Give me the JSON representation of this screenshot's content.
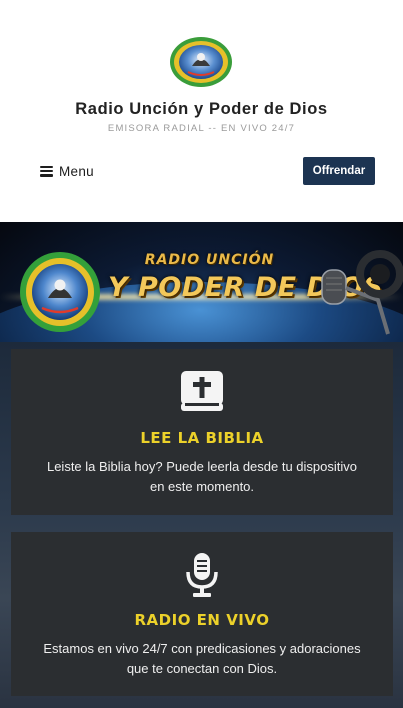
{
  "header": {
    "site_title": "Radio Unción y Poder de Dios",
    "tagline": "EMISORA RADIAL -- EN VIVO 24/7",
    "menu_label": "Menu",
    "donate_label": "Offrendar"
  },
  "banner": {
    "line1": "RADIO UNCIÓN",
    "line2": "Y PODER DE DIOS"
  },
  "cards": [
    {
      "icon": "bible-icon",
      "title": "LEE LA BIBLIA",
      "description": "Leiste la Biblia hoy? Puede leerla desde tu dispositivo en este momento."
    },
    {
      "icon": "microphone-icon",
      "title": "RADIO EN VIVO",
      "description": "Estamos en vivo 24/7 con predicasiones y adoraciones que te conectan con Dios."
    }
  ],
  "colors": {
    "donate_button": "#1c3452",
    "card_background": "#2b2e31",
    "card_title": "#ecd12a"
  }
}
